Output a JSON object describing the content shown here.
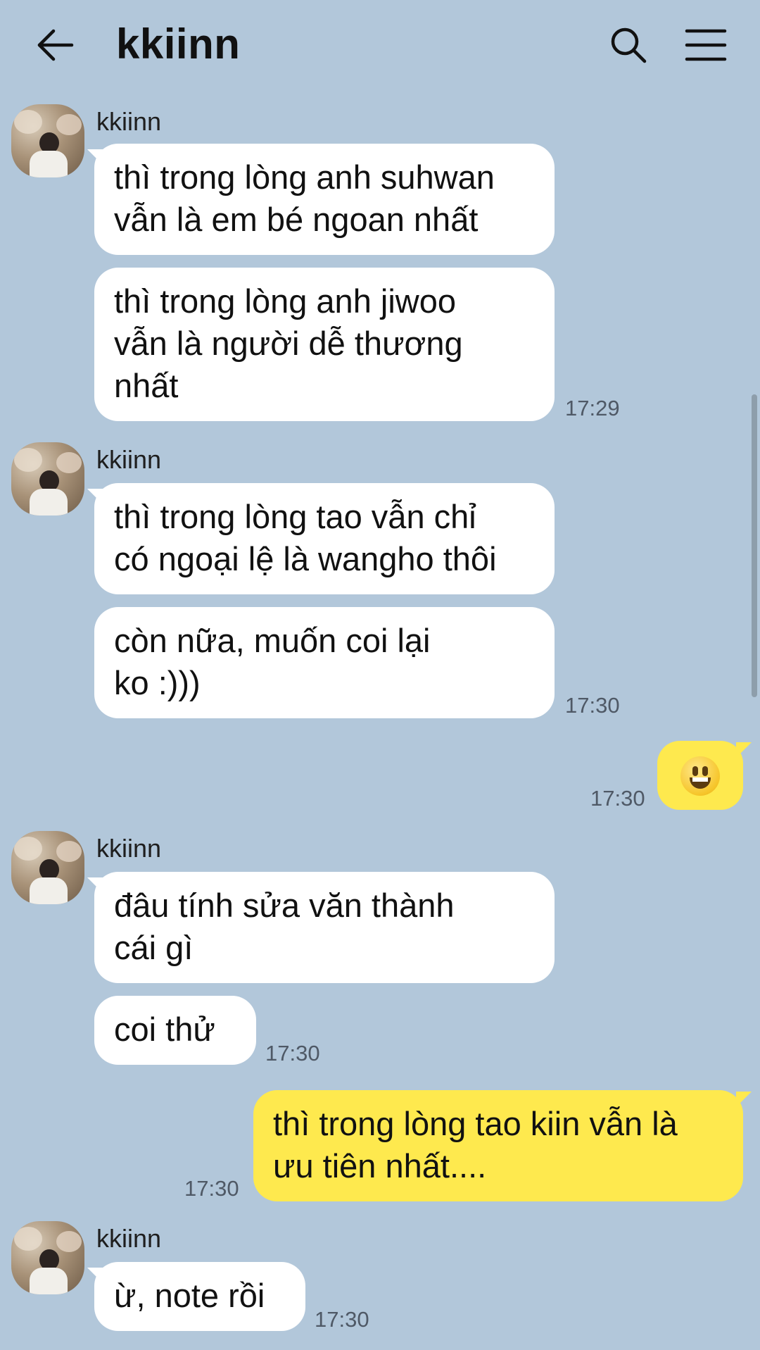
{
  "header": {
    "title": "kkiinn",
    "back_icon": "arrow-left-icon",
    "search_icon": "search-icon",
    "menu_icon": "hamburger-menu-icon"
  },
  "colors": {
    "background": "#b2c7da",
    "incoming_bubble": "#ffffff",
    "outgoing_bubble": "#fee94e"
  },
  "messages": {
    "g1": {
      "sender": "kkiinn",
      "m1": "thì trong lòng anh suhwan\nvẫn là em bé ngoan nhất",
      "m2": "thì trong lòng anh jiwoo\nvẫn là người dễ thương\nnhất",
      "time": "17:29"
    },
    "g2": {
      "sender": "kkiinn",
      "m1": "thì trong lòng tao vẫn chỉ\ncó ngoại lệ là wangho thôi",
      "m2": "còn nữa, muốn coi lại\nko :)))",
      "time": "17:30"
    },
    "me1": {
      "emoji": "grinning-face-emoji",
      "time": "17:30"
    },
    "g3": {
      "sender": "kkiinn",
      "m1": "đâu tính sửa văn thành\ncái gì",
      "m2": "coi thử",
      "time": "17:30"
    },
    "me2": {
      "text": "thì trong lòng tao kiin vẫn là\nưu tiên nhất....",
      "time": "17:30"
    },
    "g4": {
      "sender": "kkiinn",
      "m1": "ừ, note rồi",
      "time": "17:30"
    }
  }
}
